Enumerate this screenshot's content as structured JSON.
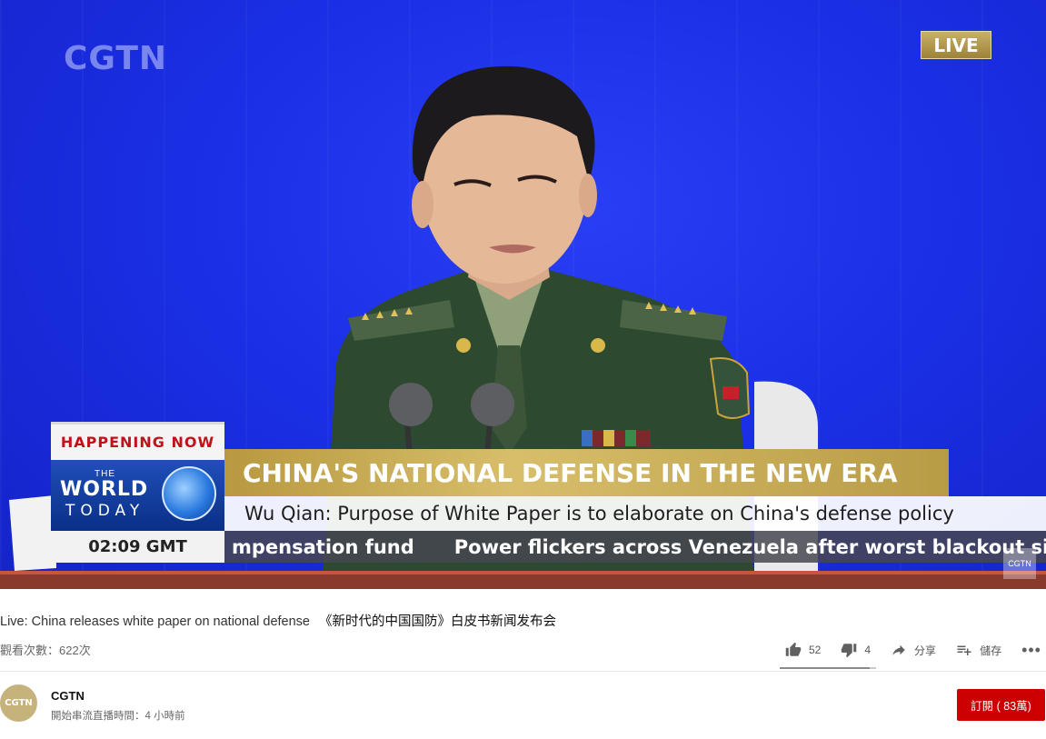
{
  "player": {
    "channel_logo": "CGTN",
    "live_badge": "LIVE",
    "lower_third": {
      "happening": "HAPPENING NOW",
      "show_the": "THE",
      "show_world": "WORLD",
      "show_today": "TODAY",
      "time": "02:09 GMT",
      "headline": "CHINA'S NATIONAL DEFENSE IN THE NEW ERA",
      "subheadline": "Wu Qian: Purpose of White Paper is to elaborate on China's defense policy",
      "ticker": [
        "mpensation fund",
        "Power flickers across Venezuela after worst blackout sinc"
      ],
      "bug": "CGTN"
    }
  },
  "video": {
    "title_en": "Live: China releases white paper on national defense",
    "title_zh": "《新时代的中国国防》白皮书新闻发布会",
    "views": "觀看次數：622次"
  },
  "actions": {
    "like_count": "52",
    "dislike_count": "4",
    "share_label": "分享",
    "save_label": "儲存",
    "more_label": "•••",
    "like_ratio": 0.93
  },
  "channel": {
    "avatar_text": "CGTN",
    "name": "CGTN",
    "stream_started": "開始串流直播時間：4 小時前",
    "subscribe_label": "訂閱 ( 83萬)"
  },
  "colors": {
    "background_blue": "#1a2fe0",
    "gold": "#c8aa55",
    "subscribe_red": "#cc0000"
  }
}
